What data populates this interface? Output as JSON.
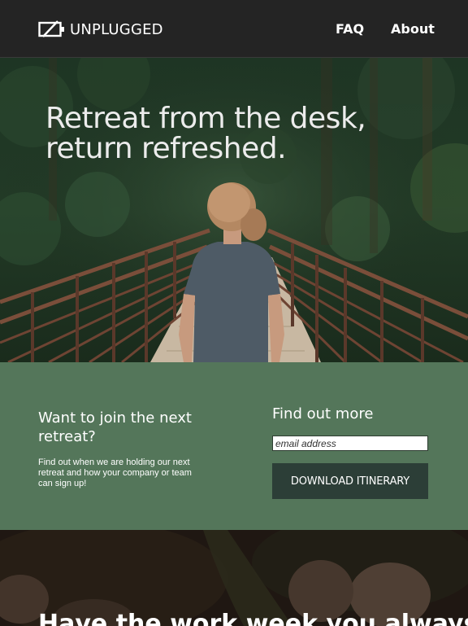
{
  "nav": {
    "logo_text": "UNPLUGGED",
    "links": [
      {
        "label": "FAQ"
      },
      {
        "label": "About"
      }
    ]
  },
  "hero": {
    "title_line1": "Retreat from the desk,",
    "title_line2": "return refreshed."
  },
  "signup": {
    "heading": "Want to join the next retreat?",
    "text": "Find out when we are holding our next retreat and how your company or team can sign up!",
    "find_heading": "Find out more",
    "email_placeholder": "email address",
    "button_label": "DOWNLOAD ITINERARY"
  },
  "bottom": {
    "title": "Have the work week you always"
  },
  "colors": {
    "nav_bg": "#242424",
    "signup_bg": "#54765a",
    "button_bg": "#2c3e37"
  }
}
